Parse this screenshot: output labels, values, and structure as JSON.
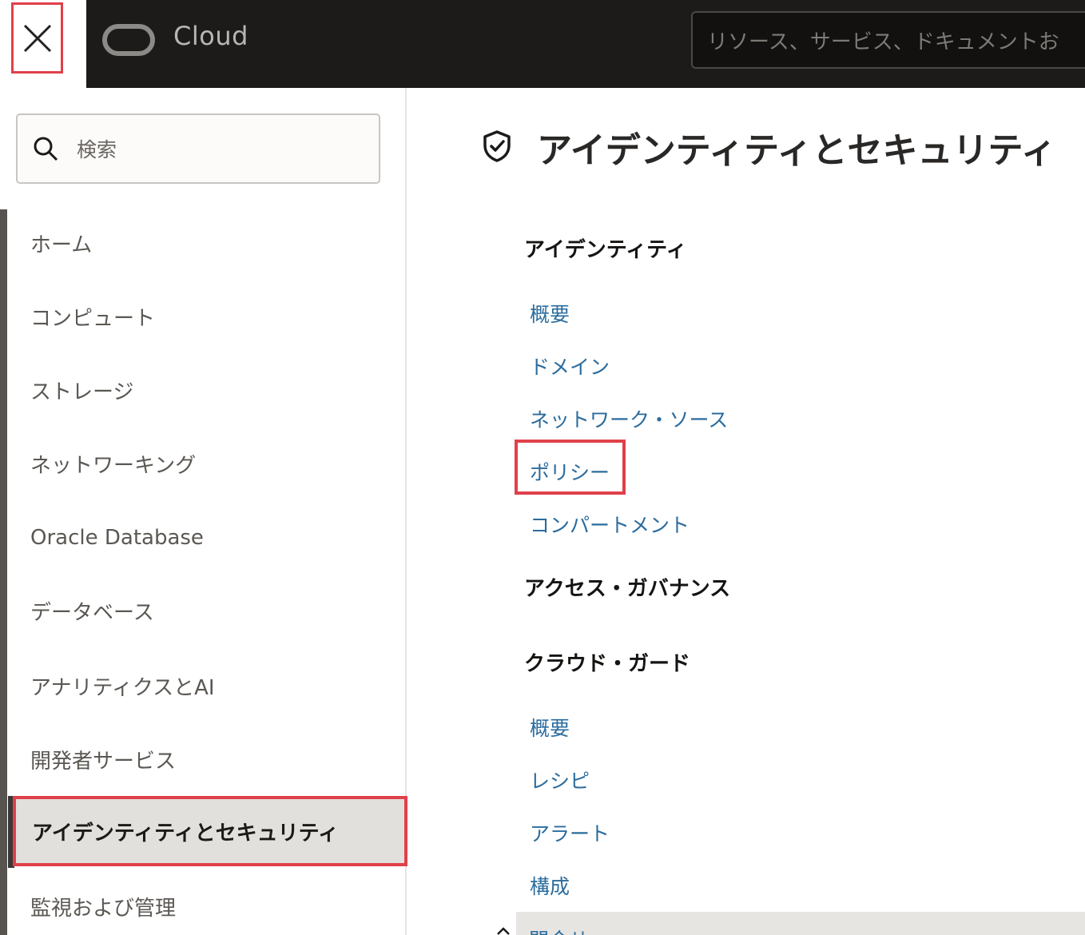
{
  "header": {
    "brand": "Cloud",
    "search_placeholder": "リソース、サービス、ドキュメントお"
  },
  "nav": {
    "search_placeholder": "検索",
    "items": [
      {
        "label": "ホーム"
      },
      {
        "label": "コンピュート"
      },
      {
        "label": "ストレージ"
      },
      {
        "label": "ネットワーキング"
      },
      {
        "label": "Oracle Database"
      },
      {
        "label": "データベース"
      },
      {
        "label": "アナリティクスとAI"
      },
      {
        "label": "開発者サービス"
      },
      {
        "label": "アイデンティティとセキュリティ",
        "active": true
      },
      {
        "label": "監視および管理"
      }
    ]
  },
  "main": {
    "title": "アイデンティティとセキュリティ",
    "sections": [
      {
        "heading": "アイデンティティ",
        "links": [
          "概要",
          "ドメイン",
          "ネットワーク・ソース",
          "ポリシー",
          "コンパートメント"
        ]
      },
      {
        "heading": "アクセス・ガバナンス",
        "links": []
      },
      {
        "heading": "クラウド・ガード",
        "links": [
          "概要",
          "レシピ",
          "アラート",
          "構成",
          "問合せ"
        ]
      }
    ]
  },
  "colors": {
    "highlight_border": "#e0404a",
    "link": "#2b6c9e",
    "topbar": "#1d1b1a"
  }
}
